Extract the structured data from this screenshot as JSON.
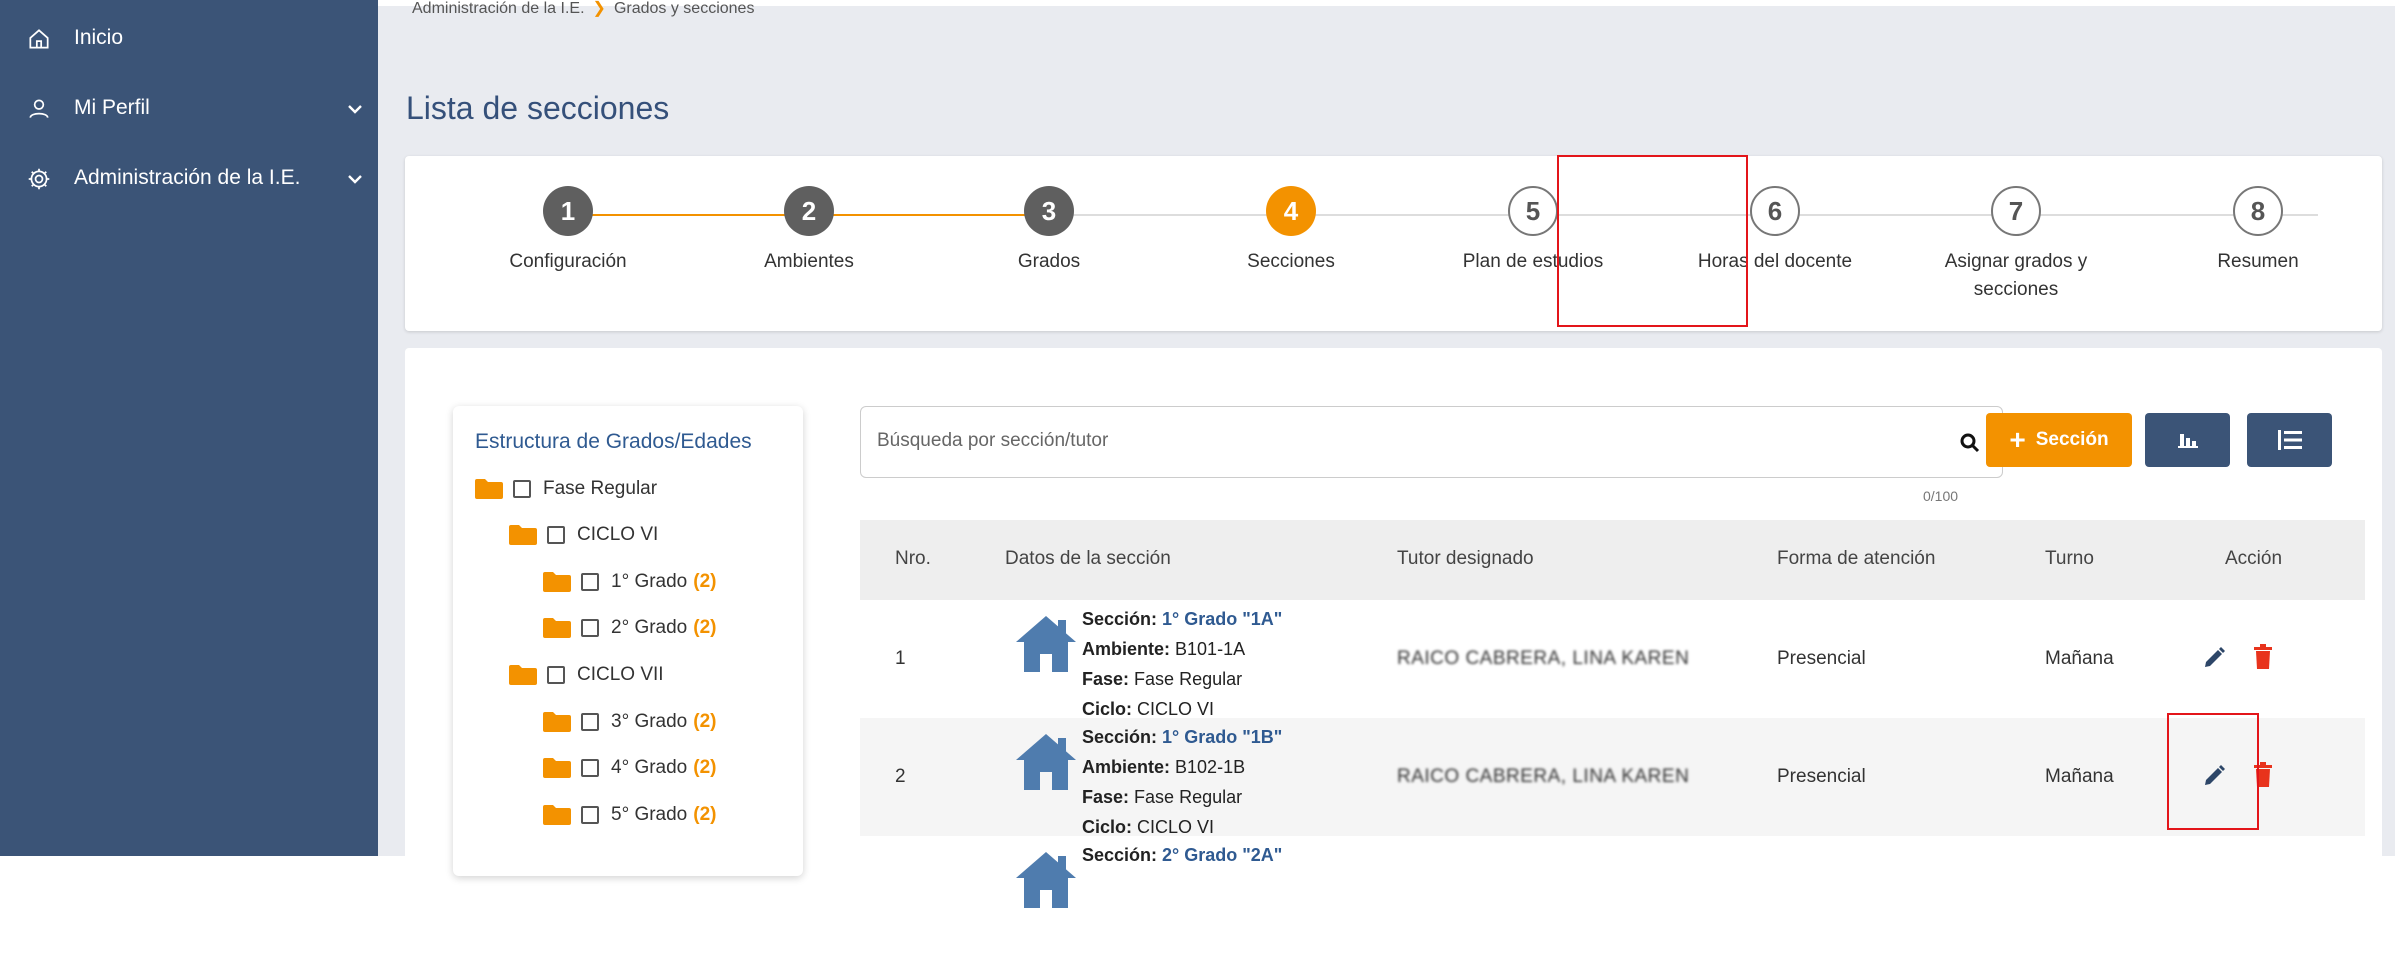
{
  "sidebar": {
    "items": [
      {
        "label": "Inicio",
        "icon": "home-icon"
      },
      {
        "label": "Mi Perfil",
        "icon": "user-icon"
      },
      {
        "label": "Administración de la I.E.",
        "icon": "gear-icon"
      }
    ]
  },
  "breadcrumb": {
    "parent": "Administración de la I.E.",
    "current": "Grados y secciones"
  },
  "page_title": "Lista de secciones",
  "stepper": {
    "steps": [
      {
        "number": "1",
        "label": "Configuración",
        "state": "done"
      },
      {
        "number": "2",
        "label": "Ambientes",
        "state": "done"
      },
      {
        "number": "3",
        "label": "Grados",
        "state": "done"
      },
      {
        "number": "4",
        "label": "Secciones",
        "state": "active"
      },
      {
        "number": "5",
        "label": "Plan de estudios",
        "state": "todo"
      },
      {
        "number": "6",
        "label": "Horas del docente",
        "state": "todo"
      },
      {
        "number": "7",
        "label": "Asignar grados y secciones",
        "state": "todo"
      },
      {
        "number": "8",
        "label": "Resumen",
        "state": "todo"
      }
    ]
  },
  "tree": {
    "title": "Estructura de Grados/Edades",
    "nodes": [
      {
        "label": "Fase Regular",
        "count": ""
      },
      {
        "label": "CICLO VI",
        "count": ""
      },
      {
        "label": "1° Grado",
        "count": "(2)"
      },
      {
        "label": "2° Grado",
        "count": "(2)"
      },
      {
        "label": "CICLO VII",
        "count": ""
      },
      {
        "label": "3° Grado",
        "count": "(2)"
      },
      {
        "label": "4° Grado",
        "count": "(2)"
      },
      {
        "label": "5° Grado",
        "count": "(2)"
      }
    ]
  },
  "search": {
    "placeholder": "Búsqueda por sección/tutor",
    "value": "",
    "counter": "0/100"
  },
  "buttons": {
    "add_label": "Sección",
    "add_icon": "plus-icon",
    "chart_icon": "bar-chart-icon",
    "list_icon": "list-icon"
  },
  "table": {
    "headers": [
      "Nro.",
      "Datos de la sección",
      "Tutor designado",
      "Forma de atención",
      "Turno",
      "Acción"
    ],
    "field_labels": {
      "seccion": "Sección:",
      "ambiente": "Ambiente:",
      "fase": "Fase:",
      "ciclo": "Ciclo:"
    },
    "rows": [
      {
        "nro": "1",
        "seccion": "1° Grado \"1A\"",
        "ambiente": "B101-1A",
        "fase": "Fase Regular",
        "ciclo": "CICLO VI",
        "tutor": "RAICO CABRERA, LINA KAREN",
        "forma": "Presencial",
        "turno": "Mañana"
      },
      {
        "nro": "2",
        "seccion": "1° Grado \"1B\"",
        "ambiente": "B102-1B",
        "fase": "Fase Regular",
        "ciclo": "CICLO VI",
        "tutor": "RAICO CABRERA, LINA KAREN",
        "forma": "Presencial",
        "turno": "Mañana"
      },
      {
        "nro": "",
        "seccion": "2° Grado \"2A\"",
        "ambiente": "",
        "fase": "",
        "ciclo": "",
        "tutor": "",
        "forma": "",
        "turno": ""
      }
    ]
  },
  "colors": {
    "sidebar": "#3b5477",
    "accent": "#f39200",
    "primary": "#3b5477",
    "danger": "#e8331c",
    "highlight": "#e3151a"
  }
}
